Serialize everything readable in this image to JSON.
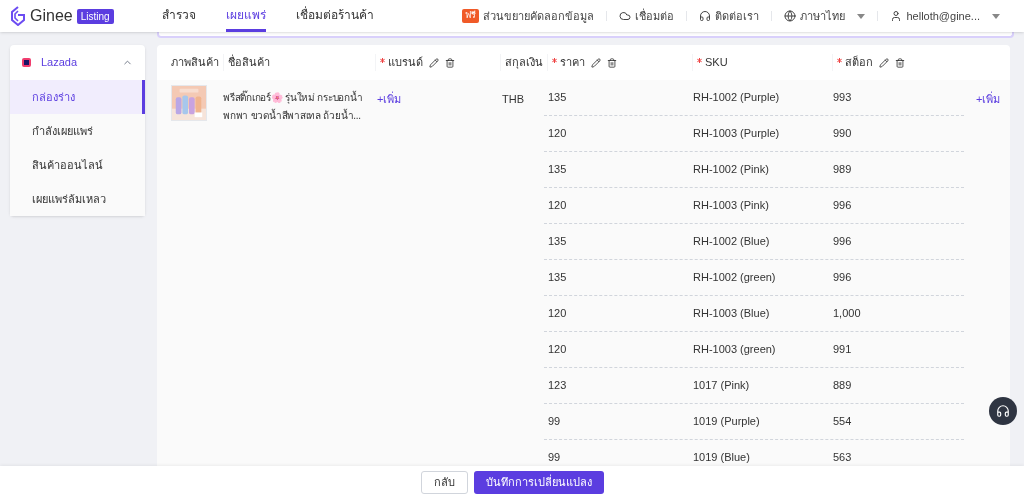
{
  "header": {
    "logo": "Ginee",
    "badge": "Listing",
    "nav": [
      {
        "label": "สำรวจ",
        "selected": false
      },
      {
        "label": "เผยแพร่",
        "selected": true
      },
      {
        "label": "เชื่อมต่อร้านค้า",
        "selected": false
      }
    ],
    "extension": {
      "tag": "ฟรี",
      "label": "ส่วนขยายคัดลอกข้อมูล"
    },
    "connect": "เชื่อมต่อ",
    "contact": "ติดต่อเรา",
    "language": "ภาษาไทย",
    "user": "helloth@gine..."
  },
  "sidebar": {
    "store": "Lazada",
    "expanded": true,
    "items": [
      {
        "label": "กล่องร่าง",
        "selected": true
      },
      {
        "label": "กำลังเผยแพร่",
        "selected": false
      },
      {
        "label": "สินค้าออนไลน์",
        "selected": false
      },
      {
        "label": "เผยแพร่ล้มเหลว",
        "selected": false
      }
    ]
  },
  "table": {
    "columns": [
      {
        "label": "ภาพสินค้า",
        "required": false,
        "editable": false
      },
      {
        "label": "ชื่อสินค้า",
        "required": false,
        "editable": false
      },
      {
        "label": "แบรนด์",
        "required": true,
        "editable": true
      },
      {
        "label": "สกุลเงิน",
        "required": false,
        "editable": false
      },
      {
        "label": "ราคา",
        "required": true,
        "editable": true
      },
      {
        "label": "SKU",
        "required": true,
        "editable": false
      },
      {
        "label": "สต็อก",
        "required": true,
        "editable": true
      }
    ],
    "product": {
      "name": "พรีสติ๊กเกอร์🌸 รุ่นใหม่ กระบอกน้ำพกพา ขวดน้ำสีพาสเทล ถ้วยน้ำ...",
      "brand_action": "+เพิ่ม",
      "currency": "THB",
      "row_action": "+เพิ่ม"
    },
    "variants": [
      {
        "price": "135",
        "sku": "RH-1002 (Purple)",
        "stock": "993"
      },
      {
        "price": "120",
        "sku": "RH-1003 (Purple)",
        "stock": "990"
      },
      {
        "price": "135",
        "sku": "RH-1002 (Pink)",
        "stock": "989"
      },
      {
        "price": "120",
        "sku": "RH-1003 (Pink)",
        "stock": "996"
      },
      {
        "price": "135",
        "sku": "RH-1002 (Blue)",
        "stock": "996"
      },
      {
        "price": "135",
        "sku": "RH-1002 (green)",
        "stock": "996"
      },
      {
        "price": "120",
        "sku": "RH-1003 (Blue)",
        "stock": "1,000"
      },
      {
        "price": "120",
        "sku": "RH-1003 (green)",
        "stock": "991"
      },
      {
        "price": "123",
        "sku": "1017 (Pink)",
        "stock": "889"
      },
      {
        "price": "99",
        "sku": "1019 (Purple)",
        "stock": "554"
      },
      {
        "price": "99",
        "sku": "1019 (Blue)",
        "stock": "563"
      }
    ]
  },
  "footer": {
    "back": "กลับ",
    "save": "บันทึกการเปลี่ยนแปลง"
  }
}
